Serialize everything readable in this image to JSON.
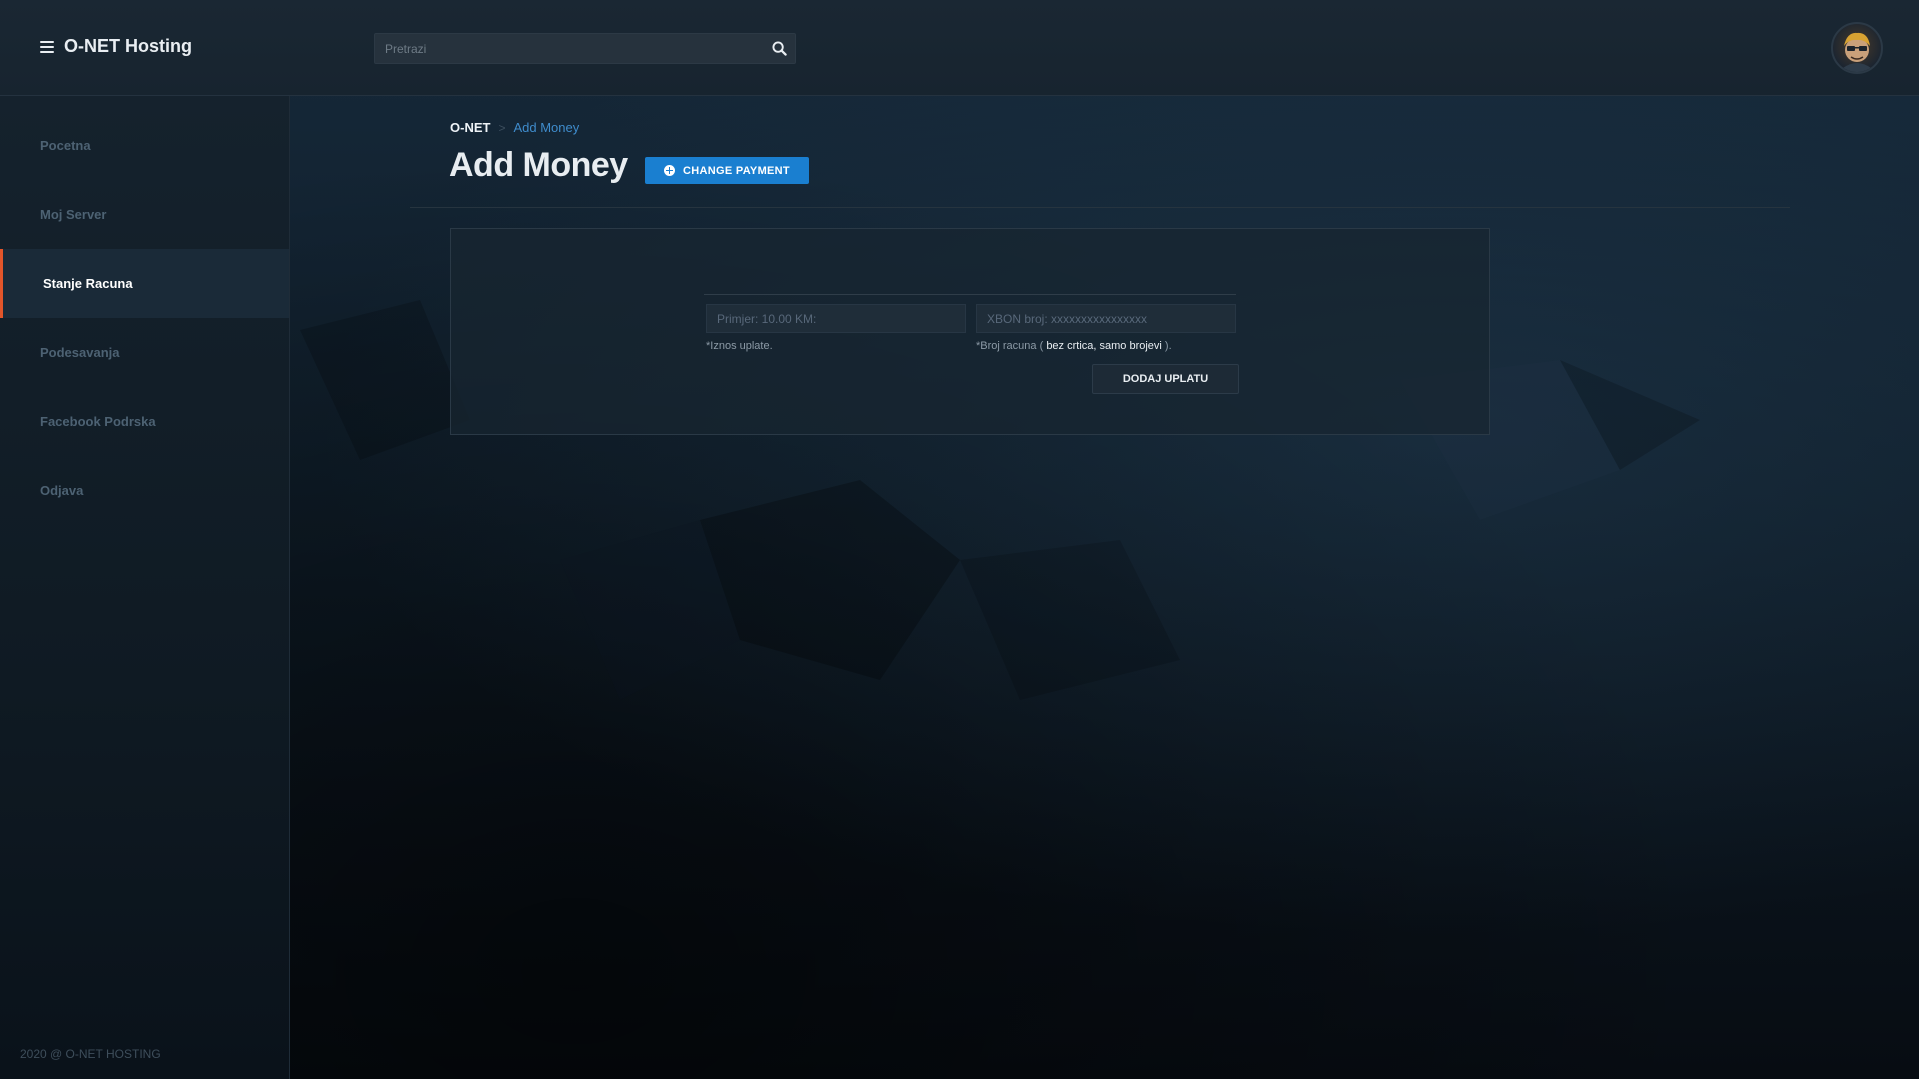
{
  "header": {
    "brand": "O-NET Hosting",
    "search_placeholder": "Pretrazi"
  },
  "sidebar": {
    "items": [
      {
        "label": "Pocetna",
        "active": false
      },
      {
        "label": "Moj Server",
        "active": false
      },
      {
        "label": "Stanje Racuna",
        "active": true
      },
      {
        "label": "Podesavanja",
        "active": false
      },
      {
        "label": "Facebook Podrska",
        "active": false
      },
      {
        "label": "Odjava",
        "active": false
      }
    ],
    "footer": "2020 @ O-NET HOSTING"
  },
  "breadcrumb": {
    "root": "O-NET",
    "separator": ">",
    "current": "Add Money"
  },
  "page": {
    "title": "Add Money",
    "change_payment_label": "CHANGE PAYMENT"
  },
  "form": {
    "amount": {
      "value": "",
      "placeholder": "Primjer: 10.00 KM:",
      "help": "*Iznos uplate."
    },
    "account": {
      "value": "",
      "placeholder": "XBON broj: xxxxxxxxxxxxxxxx",
      "help_prefix": "*Broj racuna ( ",
      "help_emphasis": "bez crtica, samo brojevi",
      "help_suffix": " )."
    },
    "submit_label": "DODAJ UPLATU"
  },
  "colors": {
    "accent": "#1a7fd0",
    "active_indicator": "#e2552a",
    "breadcrumb_link": "#3f8ccc"
  },
  "icons": {
    "menu": "hamburger-icon",
    "search": "search-icon",
    "change_payment": "plus-circle-icon",
    "avatar": "user-avatar"
  }
}
